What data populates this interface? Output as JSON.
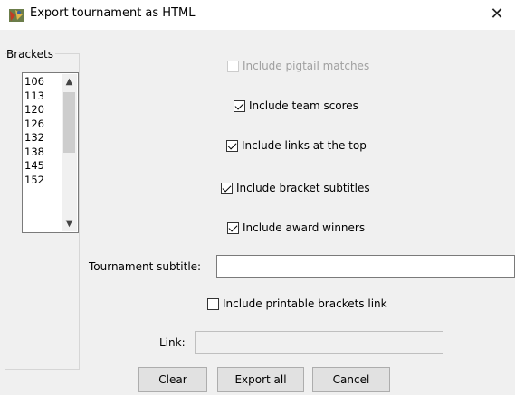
{
  "window": {
    "title": "Export tournament as HTML",
    "close_glyph": "✕",
    "icon": "tournament-app-icon"
  },
  "brackets": {
    "label": "Brackets",
    "items": [
      "106",
      "113",
      "120",
      "126",
      "132",
      "138",
      "145",
      "152"
    ]
  },
  "options": {
    "pigtail": {
      "label": "Include pigtail matches",
      "checked": false,
      "disabled": true
    },
    "team_scores": {
      "label": "Include team scores",
      "checked": true
    },
    "links_top": {
      "label": "Include links at the top",
      "checked": true
    },
    "bracket_subtitles": {
      "label": "Include bracket subtitles",
      "checked": true
    },
    "award_winners": {
      "label": "Include award winners",
      "checked": true
    },
    "printable_link": {
      "label": "Include printable brackets link",
      "checked": false
    }
  },
  "tournament_subtitle": {
    "label": "Tournament subtitle:",
    "value": ""
  },
  "link": {
    "label": "Link:",
    "value": ""
  },
  "buttons": {
    "clear": "Clear",
    "export_all": "Export all",
    "cancel": "Cancel"
  }
}
